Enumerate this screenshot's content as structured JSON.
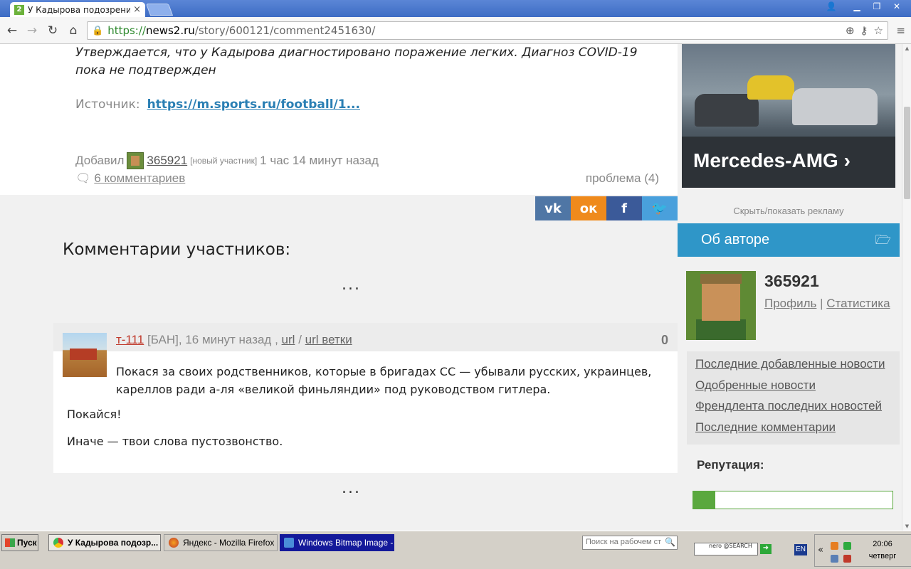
{
  "browser": {
    "tab_title": "У Кадырова подозрение на",
    "tab_close": "×",
    "favicon_label": "2",
    "url_scheme": "https://",
    "url_host": "news2.ru",
    "url_path": "/story/600121/comment2451630/",
    "window_buttons": {
      "minimize": "▁",
      "restore": "❐",
      "close": "✕"
    }
  },
  "article": {
    "quote": "Утверждается, что у Кадырова диагностировано поражение легких. Диагноз COVID-19 пока не подтвержден",
    "source_label": "Источник:",
    "source_link": "https://m.sports.ru/football/1...",
    "added_label": "Добавил",
    "author": "365921",
    "author_role": "[новый участник]",
    "added_time": "1 час 14 минут назад",
    "comments_link": "6 комментариев",
    "problem_link": "проблема (4)"
  },
  "share": [
    {
      "name": "vk",
      "label": "vk",
      "color": "#4f76a5"
    },
    {
      "name": "ok",
      "label": "ок",
      "color": "#ef8a1c"
    },
    {
      "name": "facebook",
      "label": "f",
      "color": "#3b5a99"
    },
    {
      "name": "twitter",
      "label": "🐦",
      "color": "#49a0dc"
    }
  ],
  "comments_section": {
    "title": "Комментарии участников:",
    "ellipsis": "...",
    "comment": {
      "author": "т-111",
      "status": "[БАН], 16 минут назад ,",
      "url_link": "url",
      "separator": "/",
      "branch_link": "url ветки",
      "score": "0",
      "text1": "Покася за своих родственников, которые в бригадах СС — убывали русских, украинцев, кареллов ради а-ля «великой финьляндии» под руководством гитлера.",
      "text2": "Покайся!",
      "text3": "Иначе — твои слова пустозвонство."
    }
  },
  "sidebar": {
    "ad_brand": "Mercedes-AMG ›",
    "toggle_ad": "Скрыть/показать рекламу",
    "author_header": "Об авторе",
    "author_name": "365921",
    "profile_link": "Профиль",
    "link_sep": "|",
    "stats_link": "Статистика",
    "nav_links": [
      "Последние добавленные новости",
      "Одобренные новости",
      "Френдлента последних новостей",
      "Последние комментарии"
    ],
    "reputation_label": "Репутация:",
    "reputation_fraction": 0.11
  },
  "taskbar": {
    "start_label": "Пуск",
    "tasks": [
      {
        "label": "У Кадырова подозр...",
        "active": true
      },
      {
        "label": "Яндекс - Mozilla Firefox",
        "active": false
      },
      {
        "label": "Windows Bitmap Image - ...",
        "active": false
      }
    ],
    "search_placeholder": "Поиск на рабочем ст",
    "nero_label": "nero @SEARCH",
    "lang": "EN",
    "time": "20:06",
    "day": "четверг"
  }
}
